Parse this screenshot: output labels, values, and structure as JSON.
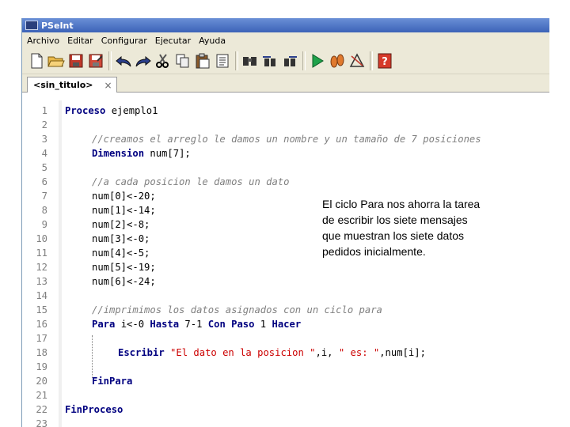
{
  "window": {
    "title": "PSeInt"
  },
  "menu": [
    "Archivo",
    "Editar",
    "Configurar",
    "Ejecutar",
    "Ayuda"
  ],
  "toolbar": {
    "icons": [
      "new-icon",
      "open-icon",
      "save-icon",
      "save-as-icon",
      "undo-icon",
      "redo-icon",
      "cut-icon",
      "copy-icon",
      "paste-icon",
      "indent-icon",
      "find-icon",
      "find-previous-icon",
      "find-next-icon",
      "run-icon",
      "step-icon",
      "diagram-icon",
      "help-icon"
    ]
  },
  "tab": {
    "label": "<sin_titulo>",
    "close": "×"
  },
  "code": {
    "lines": [
      {
        "n": "1"
      },
      {
        "n": "2"
      },
      {
        "n": "3"
      },
      {
        "n": "4"
      },
      {
        "n": "5"
      },
      {
        "n": "6"
      },
      {
        "n": "7"
      },
      {
        "n": "8"
      },
      {
        "n": "9"
      },
      {
        "n": "10"
      },
      {
        "n": "11"
      },
      {
        "n": "12"
      },
      {
        "n": "13"
      },
      {
        "n": "14"
      },
      {
        "n": "15"
      },
      {
        "n": "16"
      },
      {
        "n": "17"
      },
      {
        "n": "18"
      },
      {
        "n": "19"
      },
      {
        "n": "20"
      },
      {
        "n": "21"
      },
      {
        "n": "22"
      },
      {
        "n": "23"
      }
    ],
    "l1_kw": "Proceso",
    "l1_rest": " ejemplo1",
    "l3": "//creamos el arreglo le damos un nombre y un tamaño de 7 posiciones",
    "l4_kw": "Dimension",
    "l4_rest": " num[7];",
    "l6": "//a cada posicion le damos un dato",
    "l7": "num[0]<-20;",
    "l8": "num[1]<-14;",
    "l9": "num[2]<-8;",
    "l10": "num[3]<-0;",
    "l11": "num[4]<-5;",
    "l12": "num[5]<-19;",
    "l13": "num[6]<-24;",
    "l15": "//imprimimos los datos asignados con un ciclo para",
    "l16_a": "Para",
    "l16_b": " i<-0 ",
    "l16_c": "Hasta",
    "l16_d": " 7-1 ",
    "l16_e": "Con Paso",
    "l16_f": " 1 ",
    "l16_g": "Hacer",
    "l18_kw": "Escribir",
    "l18_str1": "\"El dato en la posicion \"",
    "l18_mid": ",i, ",
    "l18_str2": "\" es: \"",
    "l18_end": ",num[i];",
    "l20": "FinPara",
    "l22": "FinProceso"
  },
  "note": "El ciclo Para nos ahorra la tarea de escribir los siete mensajes que muestran los siete datos pedidos inicialmente."
}
